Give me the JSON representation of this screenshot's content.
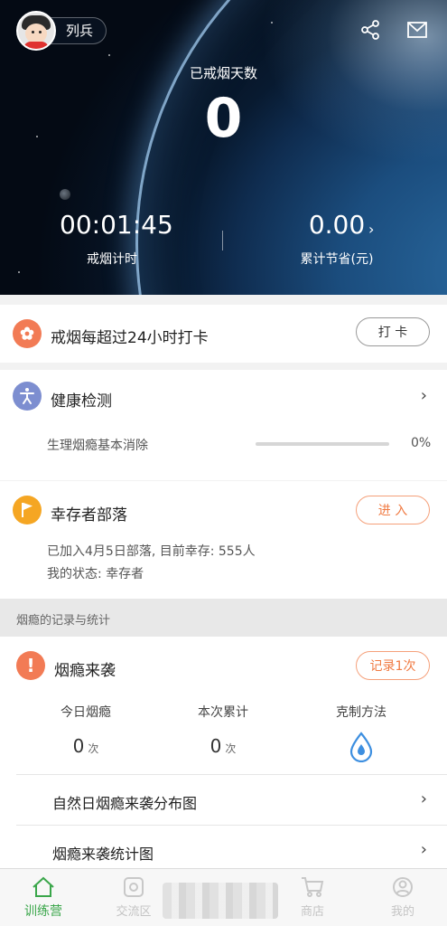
{
  "header": {
    "user_name": "列兵",
    "days_label": "已戒烟天数",
    "days_value": "0",
    "timer_value": "00:01:45",
    "timer_label": "戒烟计时",
    "savings_value": "0.00",
    "savings_arrow": "›",
    "savings_label": "累计节省(元)",
    "icons": [
      "avatar",
      "share-icon",
      "mail-icon"
    ]
  },
  "checkin": {
    "text": "戒烟每超过24小时打卡",
    "button": "打 卡",
    "icon": "flower-icon"
  },
  "health": {
    "title": "健康检测",
    "arrow": "›",
    "item_label": "生理烟瘾基本消除",
    "item_value": "0%",
    "progress": 0,
    "icon": "person-icon"
  },
  "tribe": {
    "title": "幸存者部落",
    "button": "进 入",
    "line1": "已加入4月5日部落, 目前幸存: 555人",
    "line2": "我的状态: 幸存者",
    "icon": "flag-icon"
  },
  "section": {
    "label": "烟瘾的记录与统计"
  },
  "craving": {
    "title": "烟瘾来袭",
    "icon_text": "!",
    "button": "记录1次",
    "columns": [
      {
        "label": "今日烟瘾",
        "value": "0",
        "unit": "次"
      },
      {
        "label": "本次累计",
        "value": "0",
        "unit": "次"
      },
      {
        "label": "克制方法",
        "icon": "water-drop-icon"
      }
    ],
    "links": [
      {
        "label": "自然日烟瘾来袭分布图",
        "arrow": "›"
      },
      {
        "label": "烟瘾来袭统计图",
        "arrow": "›"
      }
    ]
  },
  "tabs": [
    {
      "label": "训练营",
      "icon": "home-icon",
      "active": true
    },
    {
      "label": "交流区",
      "icon": "camera-icon",
      "active": false
    },
    {
      "label": "商店",
      "icon": "cart-icon",
      "active": false
    },
    {
      "label": "我的",
      "icon": "profile-icon",
      "active": false
    }
  ],
  "colors": {
    "accent_orange": "#f07a42",
    "active_green": "#3aa64a",
    "health_blue": "#7d8ed0",
    "tribe_yellow": "#f5a623"
  }
}
